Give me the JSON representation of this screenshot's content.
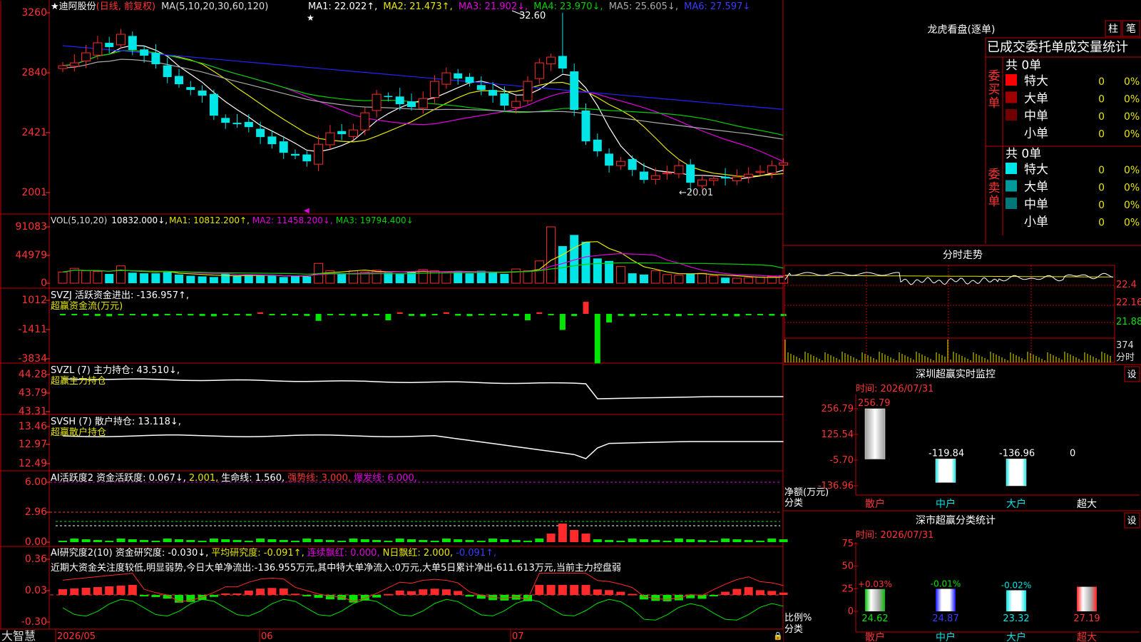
{
  "app": {
    "brand": "大智慧"
  },
  "colors": {
    "up": "#ff2a2a",
    "down": "#00e5e5",
    "grid": "#c00000",
    "bg": "#000000",
    "axis": "#ff3333",
    "ma1": "#ffffff",
    "ma2": "#e6e600",
    "ma3": "#e000e0",
    "ma4": "#00d000",
    "ma5": "#aaaaaa",
    "ma6": "#2222ff",
    "vol_ma1": "#e6e600",
    "vol_ma2": "#e000e0",
    "vol_ma3": "#00d000",
    "green": "#00e600",
    "white": "#ffffff"
  },
  "kline": {
    "stock_name": "迪阿股份",
    "period": "(日线, 前复权)",
    "ma_params": "MA(5,10,20,30,60,120)",
    "ma_values": [
      {
        "label": "MA1:",
        "value": "22.022↑,"
      },
      {
        "label": "MA2:",
        "value": "21.473↑,"
      },
      {
        "label": "MA3:",
        "value": "21.902↓,"
      },
      {
        "label": "MA4:",
        "value": "23.970↓,"
      },
      {
        "label": "MA5:",
        "value": "25.605↓,"
      },
      {
        "label": "MA6:",
        "value": "27.597↓"
      }
    ],
    "y_ticks": [
      "3260",
      "2840",
      "2421",
      "2001"
    ],
    "high_label": "32.60",
    "low_label": "←20.01",
    "dates": [
      "2026/05",
      "06",
      "07"
    ]
  },
  "vol": {
    "title": "VOL(5,10,20)",
    "value": "10832.000↓,",
    "ma1": "MA1: 10812.200↑,",
    "ma2": "MA2: 11458.200↓,",
    "ma3": "MA3: 19794.400↓",
    "y_ticks": [
      "91083",
      "44979",
      "0"
    ]
  },
  "svzj": {
    "title": "SVZJ  活跃资金进出: -136.957↑,",
    "subtitle": "超赢资金流(万元)",
    "y_ticks": [
      "1012",
      "-1411",
      "-3834"
    ]
  },
  "svzl": {
    "title": "SVZL (7) 主力持仓: 43.510↓,",
    "subtitle": "超赢主力持仓",
    "y_ticks": [
      "44.28",
      "43.79",
      "43.31"
    ]
  },
  "svsh": {
    "title": "SVSH (7) 散户持仓: 13.118↓,",
    "subtitle": "超赢散户持仓",
    "y_ticks": [
      "13.46",
      "12.97",
      "12.49"
    ]
  },
  "ai_active": {
    "title": "AI活跃度2 资金活跃度: 0.067↓,",
    "v2": "2.001,",
    "life": "生命线: 1.560,",
    "strong": "强势线: 3.000,",
    "burst": "爆发线: 6.000,",
    "y_ticks": [
      "6.00",
      "2.96",
      "0.00"
    ]
  },
  "ai_research": {
    "title": "AI研究度2(10) 资金研究度: -0.030↓,",
    "avg": "平均研究度: -0.091↑,",
    "cont": "连续飘红: 0.000,",
    "nday": "N日飘红: 2.000,",
    "last": "-0.091↑,",
    "comment": "近期大资金关注度较低,明显弱势,今日大单净流出:-136.955万元,其中特大单净流入:0万元,大单5日累计净出-611.613万元,当前主力控盘弱",
    "y_ticks": [
      "0.36",
      "0.03",
      "-0.30"
    ]
  },
  "right": {
    "longhu": {
      "title": "龙虎看盘(逐单)",
      "btn1": "柱",
      "btn2": "笔"
    },
    "order_table": {
      "header": "已成交委托单成交量统计",
      "buy": {
        "side": "委买单",
        "total": "共 0单",
        "rows": [
          {
            "label": "特大",
            "qty": "0",
            "pct": "0%"
          },
          {
            "label": "大单",
            "qty": "0",
            "pct": "0%"
          },
          {
            "label": "中单",
            "qty": "0",
            "pct": "0%"
          },
          {
            "label": "小单",
            "qty": "0",
            "pct": "0%"
          }
        ]
      },
      "sell": {
        "side": "委卖单",
        "total": "共 0单",
        "rows": [
          {
            "label": "特大",
            "qty": "0",
            "pct": "0%"
          },
          {
            "label": "大单",
            "qty": "0",
            "pct": "0%"
          },
          {
            "label": "中单",
            "qty": "0",
            "pct": "0%"
          },
          {
            "label": "小单",
            "qty": "0",
            "pct": "0%"
          }
        ]
      }
    },
    "intraday": {
      "title": "分时走势",
      "y_ticks": [
        "22.4",
        "22.16",
        "21.88"
      ],
      "vol_label": "374",
      "unit": "分时"
    },
    "monitor": {
      "title": "深圳超赢实时监控",
      "btn": "设",
      "time": "时间: 2026/07/31",
      "y_ticks": [
        "256.79",
        "125.54",
        "-5.70",
        "-136.96"
      ],
      "ylabel1": "净额(万元)",
      "ylabel2": "分类",
      "categories": [
        "散户",
        "中户",
        "大户",
        "超大"
      ],
      "values": [
        256.79,
        -119.84,
        -136.96,
        0
      ],
      "labels": [
        "256.79",
        "-119.84",
        "-136.96",
        "0"
      ]
    },
    "classify": {
      "title": "深市超赢分类统计",
      "btn": "设",
      "time": "时间: 2026/07/31",
      "y_ticks": [
        "75",
        "50",
        "25",
        "0"
      ],
      "ylabel1": "比例%",
      "ylabel2": "分类",
      "categories": [
        "散户",
        "中户",
        "大户",
        "超大"
      ],
      "values": [
        24.62,
        24.87,
        23.32,
        27.19
      ],
      "changes": [
        "+0.03%",
        "-0.01%",
        "-0.02%",
        ""
      ]
    }
  },
  "chart_data": [
    {
      "type": "bar",
      "title": "深圳超赢实时监控",
      "ylabel": "净额(万元)",
      "categories": [
        "散户",
        "中户",
        "大户",
        "超大"
      ],
      "values": [
        256.79,
        -119.84,
        -136.96,
        0
      ],
      "ylim": [
        -136.96,
        256.79
      ]
    },
    {
      "type": "bar",
      "title": "深市超赢分类统计",
      "ylabel": "比例%",
      "categories": [
        "散户",
        "中户",
        "大户",
        "超大"
      ],
      "values": [
        24.62,
        24.87,
        23.32,
        27.19
      ],
      "ylim": [
        0,
        75
      ]
    },
    {
      "type": "line",
      "title": "迪阿股份",
      "ylim": [
        20.01,
        32.6
      ],
      "series": [
        {
          "values": [
            28.9,
            29.1,
            29.8,
            30.5,
            30.2,
            31.1,
            30.0,
            29.6,
            29.0,
            28.1,
            27.6,
            27.2,
            26.8,
            25.4,
            24.9,
            24.8,
            24.6,
            23.9,
            23.4,
            22.8,
            22.6,
            22.2,
            23.4,
            24.2,
            24.1,
            24.4,
            25.6,
            26.9,
            26.7,
            26.2,
            26.0,
            26.6,
            27.8,
            28.4,
            28.0,
            27.7,
            27.2,
            26.8,
            26.1,
            26.4,
            27.8,
            29.1,
            29.5,
            28.7,
            25.8,
            23.6,
            22.9,
            21.9,
            22.2,
            21.6,
            20.9,
            21.2,
            21.4,
            21.9,
            20.7,
            20.9,
            21.0,
            21.0,
            21.1,
            21.3,
            21.5,
            21.9,
            22.1
          ]
        },
        {
          "name": "VOL",
          "values": [
            18000,
            24000,
            20000,
            19000,
            15000,
            28000,
            17000,
            16000,
            16000,
            18000,
            14000,
            12000,
            11000,
            10000,
            15000,
            12000,
            14000,
            12000,
            12000,
            10000,
            12000,
            11000,
            32000,
            20000,
            16000,
            20000,
            18000,
            21000,
            17000,
            16000,
            18000,
            22000,
            20000,
            17000,
            19000,
            16000,
            20000,
            17000,
            15000,
            23000,
            20000,
            36000,
            91083,
            60000,
            78000,
            67000,
            40000,
            36000,
            27000,
            16000,
            14000,
            20000,
            14000,
            13000,
            15000,
            16000,
            12000,
            9000,
            8000,
            9000,
            10000,
            10832,
            12000
          ]
        }
      ]
    }
  ]
}
